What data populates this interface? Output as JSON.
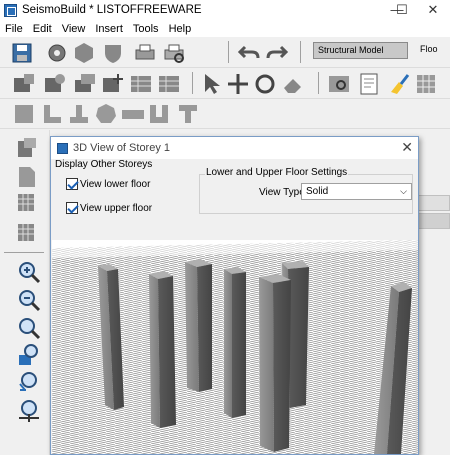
{
  "window": {
    "title": "SeismoBuild * LISTOFFREEWARE",
    "minimize": "—",
    "maximize": "☐",
    "close": "✕"
  },
  "menu": [
    "File",
    "Edit",
    "View",
    "Insert",
    "Tools",
    "Help"
  ],
  "toolbar": {
    "model_combo": "Structural Model",
    "floor_combo": "Floo"
  },
  "dialog": {
    "title": "3D View of Storey 1",
    "display_group": "Display Other Storeys",
    "view_lower": "View lower floor",
    "view_upper": "View upper floor",
    "floor_group": "Lower and Upper Floor Settings",
    "view_type_label": "View Type",
    "view_type_value": "Solid"
  },
  "colors": {
    "accent": "#2a6fb8",
    "column": "#8c8c8c"
  }
}
